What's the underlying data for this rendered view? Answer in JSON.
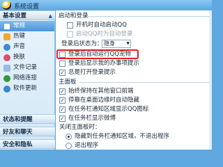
{
  "window": {
    "title": "系统设置"
  },
  "sidebar": {
    "section_basic": "基本设置",
    "items": [
      {
        "label": "常规",
        "icon": "document-icon",
        "active": true
      },
      {
        "label": "热键",
        "icon": "hotkey-icon",
        "active": false
      },
      {
        "label": "声音",
        "icon": "sound-icon",
        "active": false
      },
      {
        "label": "换肤",
        "icon": "skin-icon",
        "active": false
      },
      {
        "label": "文件记录",
        "icon": "file-record-icon",
        "active": false
      },
      {
        "label": "网络连接",
        "icon": "network-icon",
        "active": false
      },
      {
        "label": "软件更新",
        "icon": "update-icon",
        "active": false
      }
    ],
    "section_status": "状态和提醒",
    "section_friends": "好友和聊天",
    "section_security": "安全和隐私"
  },
  "main": {
    "startup": {
      "header": "启动和登录",
      "options": [
        {
          "label": "开机时自动启动QQ",
          "checked": false,
          "disabled": false
        },
        {
          "label": "启动QQ时为自动登录",
          "checked": false,
          "disabled": true
        }
      ],
      "login_status_label": "登录后状态为：",
      "login_status_value": "隐身",
      "more_options": [
        {
          "label": "登录后自动运行QQ宠物",
          "checked": false,
          "highlighted": true
        },
        {
          "label": "登录后显示我的办事项提示",
          "checked": false
        },
        {
          "label": "总是打开登录提示",
          "checked": true
        }
      ]
    },
    "main_panel": {
      "header": "主面板",
      "options": [
        {
          "label": "始终保持在其他窗口前端",
          "checked": true
        },
        {
          "label": "停靠在桌面边缘时自动隐藏",
          "checked": true
        },
        {
          "label": "在任务栏通知区域显示QQ图标",
          "checked": true
        },
        {
          "label": "在任务栏显示微博",
          "checked": true
        }
      ],
      "close_label": "关闭主面板时：",
      "close_options": [
        {
          "label": "隐藏到任务栏通知区域，不退出程序",
          "selected": true
        },
        {
          "label": "退出程序",
          "selected": false
        }
      ]
    }
  }
}
